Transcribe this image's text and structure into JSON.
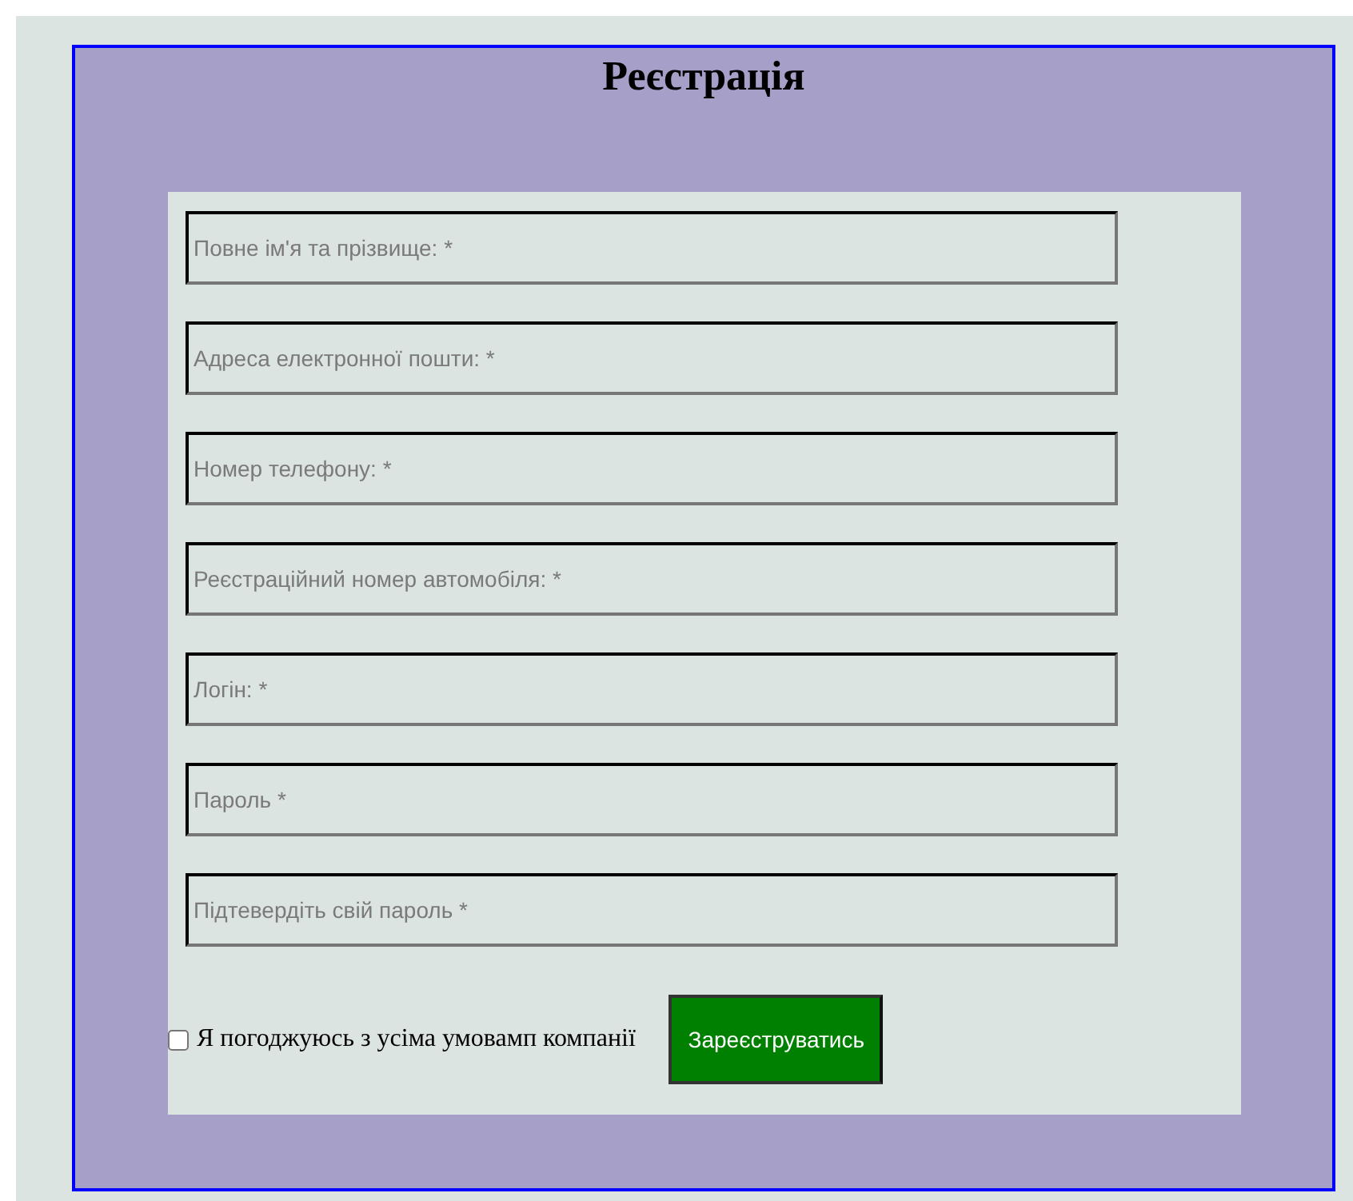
{
  "title": "Реєстрація",
  "fields": [
    {
      "placeholder": "Повне ім'я та прізвище: *"
    },
    {
      "placeholder": "Адреса електронної пошти: *"
    },
    {
      "placeholder": "Номер телефону: *"
    },
    {
      "placeholder": "Реєстраційний номер автомобіля: *"
    },
    {
      "placeholder": "Логін: *"
    },
    {
      "placeholder": "Пароль *"
    },
    {
      "placeholder": "Підтевердіть свій пароль *"
    }
  ],
  "agreement": {
    "label": "Я погоджуюсь з усіма умовамп компанії",
    "checked": false
  },
  "submit_button": "Зареєструватись"
}
